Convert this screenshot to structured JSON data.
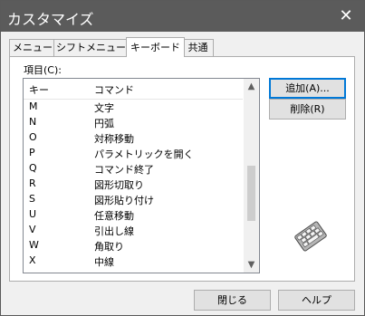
{
  "window": {
    "title": "カスタマイズ",
    "close_glyph": "✕"
  },
  "tabs": [
    {
      "label": "メニュー"
    },
    {
      "label": "シフトメニュー"
    },
    {
      "label": "キーボード",
      "active": true
    },
    {
      "label": "共通"
    }
  ],
  "list": {
    "caption": "項目(C):",
    "headers": [
      "キー",
      "コマンド"
    ],
    "rows": [
      {
        "key": "M",
        "command": "文字"
      },
      {
        "key": "N",
        "command": "円弧"
      },
      {
        "key": "O",
        "command": "対称移動"
      },
      {
        "key": "P",
        "command": "パラメトリックを開く"
      },
      {
        "key": "Q",
        "command": "コマンド終了"
      },
      {
        "key": "R",
        "command": "図形切取り"
      },
      {
        "key": "S",
        "command": "図形貼り付け"
      },
      {
        "key": "U",
        "command": "任意移動"
      },
      {
        "key": "V",
        "command": "引出し線"
      },
      {
        "key": "W",
        "command": "角取り"
      },
      {
        "key": "X",
        "command": "中線"
      }
    ]
  },
  "buttons": {
    "add": "追加(A)...",
    "delete": "削除(R)",
    "close": "閉じる",
    "help": "ヘルプ"
  },
  "icons": {
    "keyboard": "keyboard-icon"
  }
}
